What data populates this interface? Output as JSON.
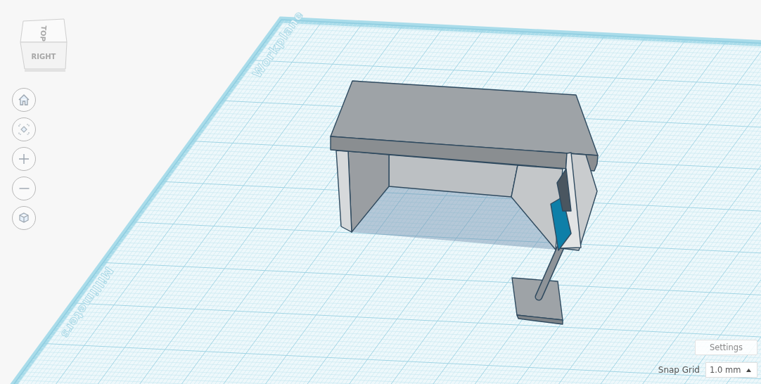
{
  "view_cube": {
    "top_label": "TOP",
    "front_label": "RIGHT"
  },
  "workplane": {
    "title": "Workplane",
    "units": "Millimeters"
  },
  "settings_button": "Settings",
  "snap_grid": {
    "label": "Snap Grid",
    "value": "1.0 mm"
  }
}
